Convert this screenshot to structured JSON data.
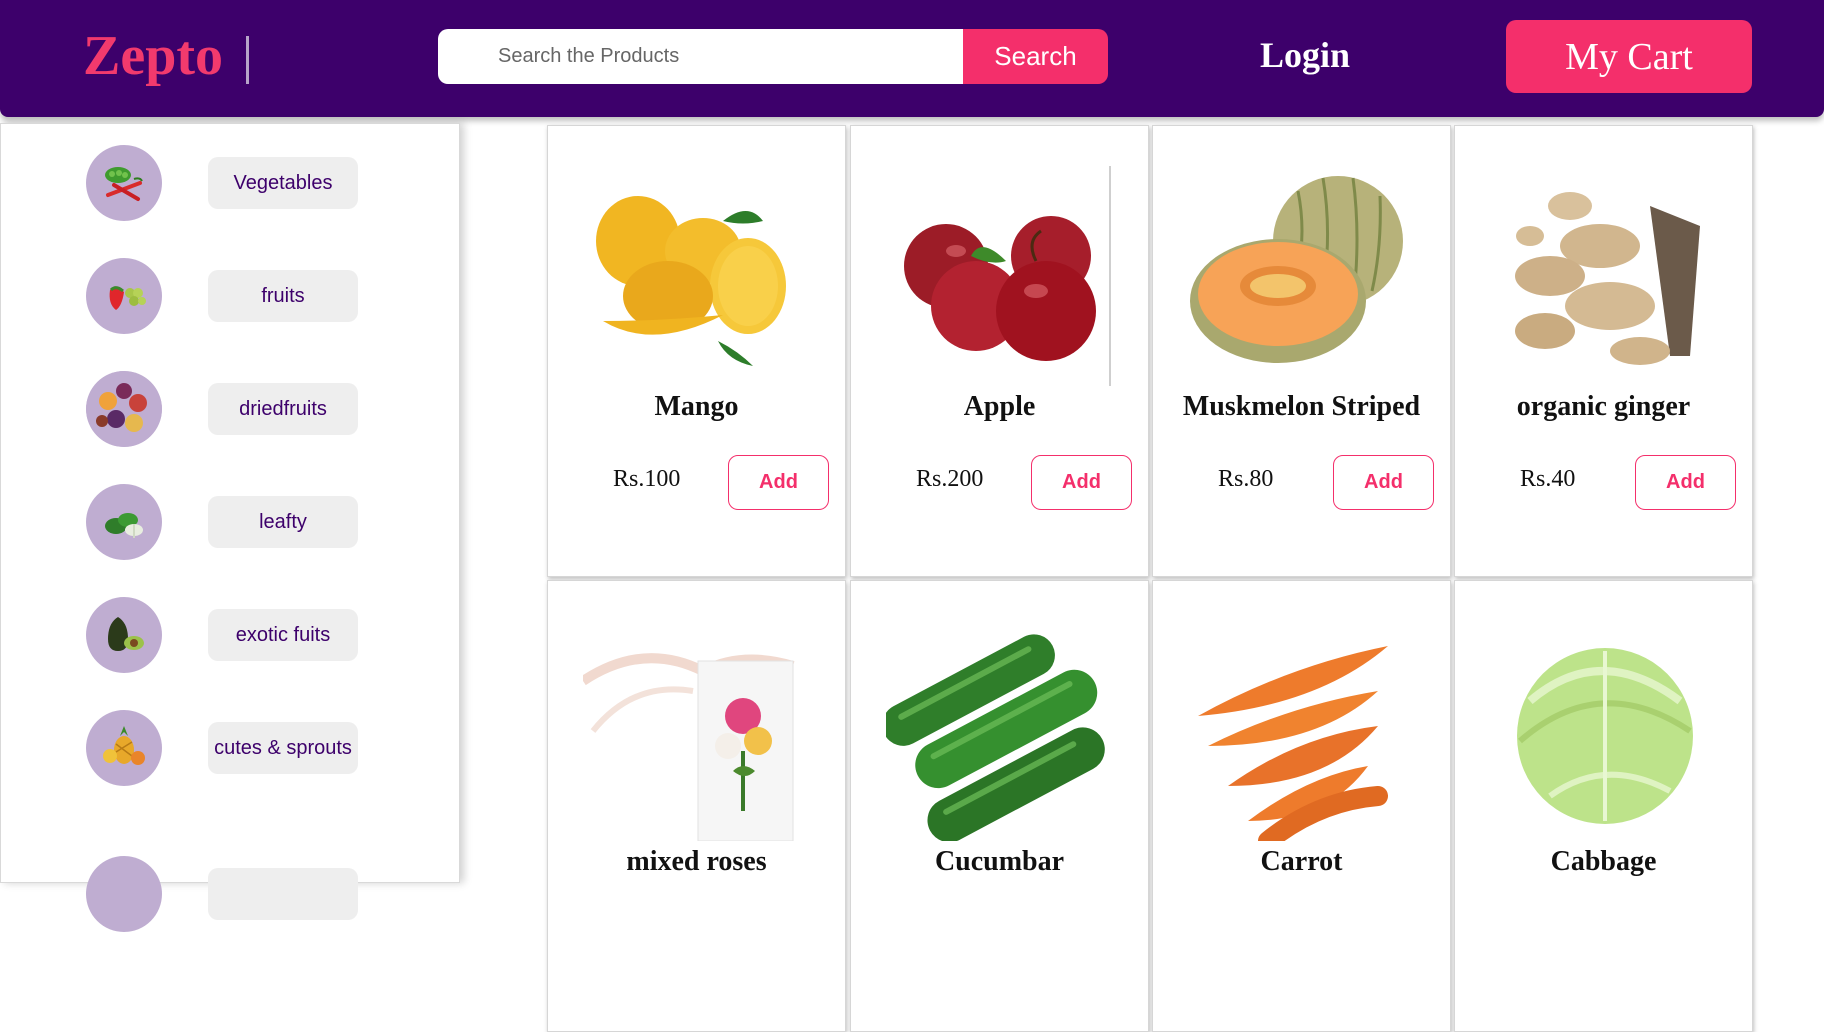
{
  "header": {
    "brand": "Zepto",
    "search_placeholder": "Search the Products",
    "search_button": "Search",
    "login": "Login",
    "cart": "My Cart"
  },
  "sidebar": {
    "categories": [
      {
        "label": "Vegetables",
        "icon": "vegetables-icon"
      },
      {
        "label": "fruits",
        "icon": "fruits-icon"
      },
      {
        "label": "driedfruits",
        "icon": "dried-fruits-icon"
      },
      {
        "label": "leafty",
        "icon": "leafy-icon"
      },
      {
        "label": "exotic fuits",
        "icon": "avocado-icon"
      },
      {
        "label": "cutes & sprouts",
        "icon": "pineapple-icon"
      },
      {
        "label": "",
        "icon": "category-icon"
      }
    ]
  },
  "products": [
    {
      "name": "Mango",
      "price": "Rs.100",
      "add": "Add",
      "icon": "mango-icon"
    },
    {
      "name": "Apple",
      "price": "Rs.200",
      "add": "Add",
      "icon": "apple-icon"
    },
    {
      "name": "Muskmelon Striped",
      "price": "Rs.80",
      "add": "Add",
      "icon": "muskmelon-icon"
    },
    {
      "name": "organic ginger",
      "price": "Rs.40",
      "add": "Add",
      "icon": "ginger-icon"
    },
    {
      "name": "mixed roses",
      "price": "",
      "add": "",
      "icon": "roses-icon"
    },
    {
      "name": "Cucumbar",
      "price": "",
      "add": "",
      "icon": "cucumber-icon"
    },
    {
      "name": "Carrot",
      "price": "",
      "add": "",
      "icon": "carrot-icon"
    },
    {
      "name": "Cabbage",
      "price": "",
      "add": "",
      "icon": "cabbage-icon"
    }
  ],
  "colors": {
    "brand_purple": "#3d006b",
    "accent_pink": "#f42f6b",
    "category_circle": "#bfadd1"
  }
}
